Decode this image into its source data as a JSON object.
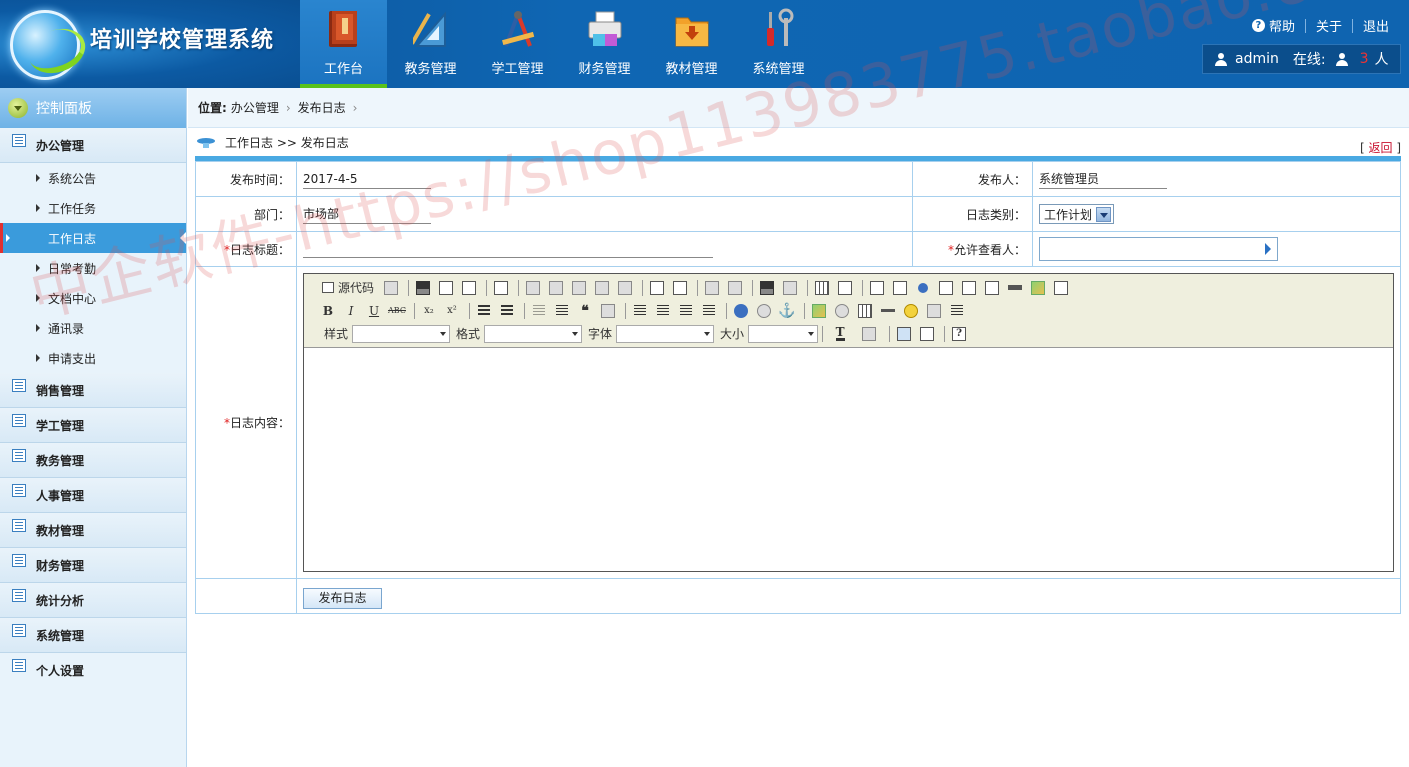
{
  "app": {
    "title": "培训学校管理系统"
  },
  "nav": [
    {
      "label": "工作台",
      "icon": "book-icon",
      "active": true
    },
    {
      "label": "教务管理",
      "icon": "ruler-icon"
    },
    {
      "label": "学工管理",
      "icon": "compass-icon"
    },
    {
      "label": "财务管理",
      "icon": "printer-icon"
    },
    {
      "label": "教材管理",
      "icon": "folder-icon"
    },
    {
      "label": "系统管理",
      "icon": "tools-icon"
    }
  ],
  "toplinks": {
    "help": "帮助",
    "about": "关于",
    "logout": "退出"
  },
  "userbar": {
    "username": "admin",
    "online_label": "在线:",
    "online_count": "3",
    "online_unit": "人"
  },
  "sidebar": {
    "panel_title": "控制面板",
    "groups": [
      {
        "label": "办公管理",
        "expanded": true,
        "items": [
          "系统公告",
          "工作任务",
          "工作日志",
          "日常考勤",
          "文档中心",
          "通讯录",
          "申请支出"
        ],
        "active_item": "工作日志"
      },
      {
        "label": "销售管理"
      },
      {
        "label": "学工管理"
      },
      {
        "label": "教务管理"
      },
      {
        "label": "人事管理"
      },
      {
        "label": "教材管理"
      },
      {
        "label": "财务管理"
      },
      {
        "label": "统计分析"
      },
      {
        "label": "系统管理"
      },
      {
        "label": "个人设置"
      }
    ]
  },
  "breadcrumb": {
    "label": "位置:",
    "items": [
      "办公管理",
      "发布日志"
    ]
  },
  "page": {
    "title": "工作日志 >> 发布日志",
    "back_left": "[",
    "back_label": "返回",
    "back_right": "]"
  },
  "form": {
    "publish_time_label": "发布时间：",
    "publish_time_value": "2017-4-5",
    "publisher_label": "发布人：",
    "publisher_value": "系统管理员",
    "department_label": "部门：",
    "department_value": "市场部",
    "log_type_label": "日志类别：",
    "log_type_value": "工作计划",
    "required_mark": "*",
    "log_title_label": "日志标题：",
    "viewers_label": "允许查看人：",
    "content_label": "日志内容：",
    "submit_label": "发布日志"
  },
  "editor": {
    "source_label": "源代码",
    "style_label": "样式",
    "format_label": "格式",
    "font_label": "字体",
    "size_label": "大小",
    "bold": "B",
    "italic": "I",
    "underline": "U",
    "strike": "ABC",
    "subscript": "x₂",
    "superscript": "x²"
  },
  "watermark": "中企软件-https://shop113983775.taobao.com",
  "colors": {
    "header": "#0f64b0",
    "accent": "#49a9e2",
    "active_nav_bar": "#5ac21a",
    "link_red": "#c8102e"
  }
}
